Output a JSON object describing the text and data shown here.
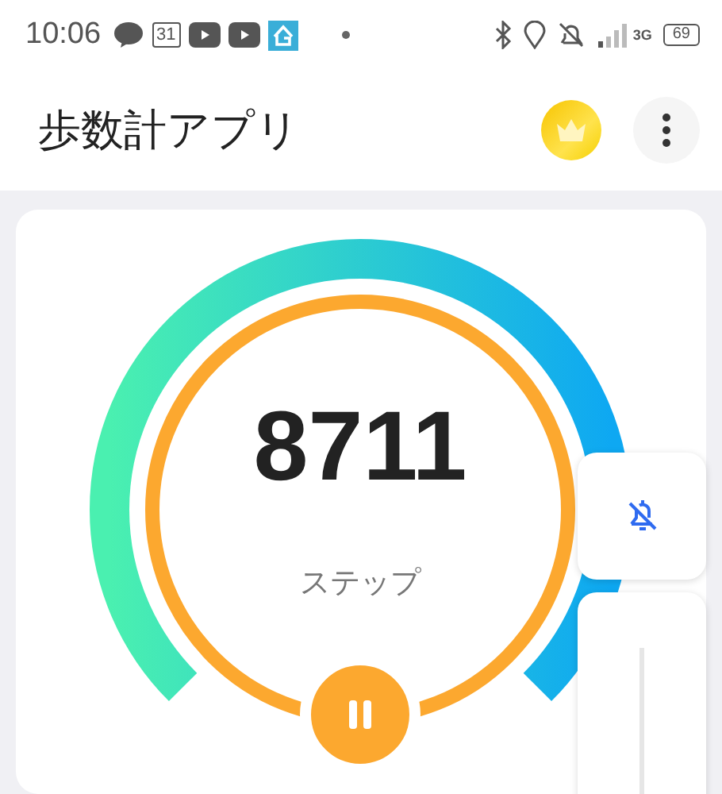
{
  "status_bar": {
    "time": "10:06",
    "calendar_day": "31",
    "network": "3G",
    "battery": "69"
  },
  "app_bar": {
    "title": "歩数計アプリ"
  },
  "counter": {
    "steps": "8711",
    "unit": "ステップ",
    "paused": false
  },
  "volume_panel": {
    "muted": true
  }
}
